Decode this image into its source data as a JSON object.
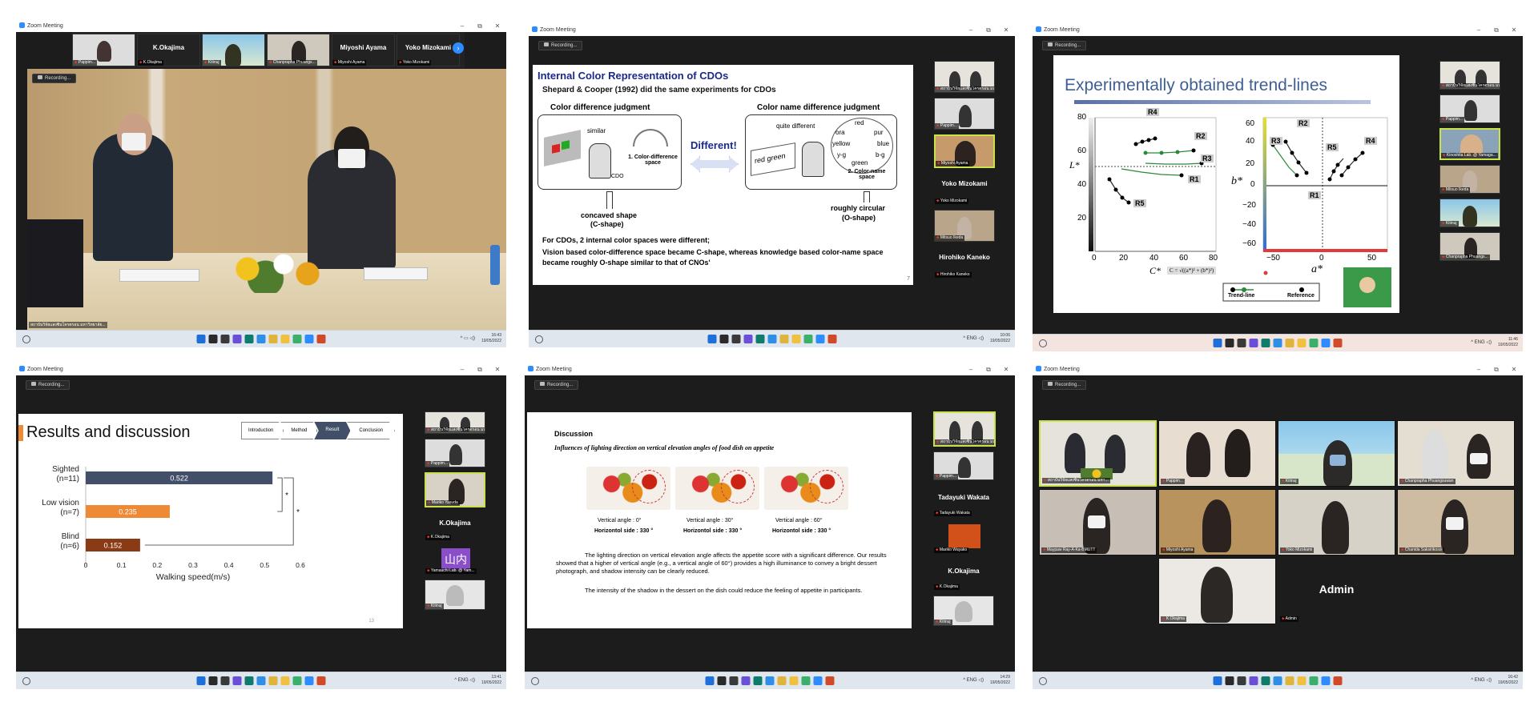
{
  "app_title": "Zoom Meeting",
  "recording_label": "Recording...",
  "win_controls": {
    "min": "–",
    "max": "⧉",
    "close": "✕"
  },
  "taskbar_lang": "ENG",
  "panels": [
    {
      "time": "16:43",
      "date": "19/05/2022"
    },
    {
      "time": "10:06",
      "date": "19/05/2022"
    },
    {
      "time": "11:46",
      "date": "19/05/2022"
    },
    {
      "time": "13:41",
      "date": "19/05/2022"
    },
    {
      "time": "14:29",
      "date": "19/05/2022"
    },
    {
      "time": "16:42",
      "date": "19/05/2022"
    }
  ],
  "p1": {
    "strip": [
      {
        "label": "Pappim..."
      },
      {
        "name": "K.Okajima",
        "label": "K.Okajima"
      },
      {
        "label": "Kitinuj"
      },
      {
        "label": "Chanprapha Phuangs..."
      },
      {
        "name": "Miyoshi Ayama",
        "label": "Miyoshi Ayama"
      },
      {
        "name": "Yoko Mizokami",
        "label": "Yoko Mizokami"
      }
    ],
    "main_caption": "สถาบันวิจัยแสงซินโครตรอน มหาวิทยาลัย..."
  },
  "p2": {
    "slide_title": "Internal Color Representation of CDOs",
    "subtitle": "Shepard & Cooper (1992) did the same experiments for CDOs",
    "left_heading": "Color difference judgment",
    "similar": "similar",
    "cd_space": "1. Color-difference space",
    "cdo": "CDO",
    "different": "Different!",
    "right_heading": "Color name difference judgment",
    "quite_diff": "quite different",
    "red_green": "red  green",
    "colors": [
      "red",
      "ora",
      "pur",
      "yellow",
      "blue",
      "y-g",
      "b-g",
      "green"
    ],
    "cn_space": "2. Color-name space",
    "concave": "concaved shape",
    "cshape": "(C-shape)",
    "circular": "roughly circular",
    "oshape": "(O-shape)",
    "body": "For CDOs, 2 internal color spaces were different;",
    "body2": "Vision based color-difference space became C-shape, whereas knowledge based color-name space became roughly O-shape similar to that of CNOs'",
    "page": "7",
    "sidebar": [
      {
        "label": "สถาบันวิจัยแสงซินโครตรอน มหา..."
      },
      {
        "label": "Pappim..."
      },
      {
        "label": "Miyoshi Ayama"
      },
      {
        "name": "Yoko Mizokami",
        "label": "Yoko Mizokami"
      },
      {
        "label": "Mitsuo Ikeda"
      },
      {
        "name": "Hirohiko Kaneko",
        "label": "Hirohiko Kaneko"
      }
    ]
  },
  "p3": {
    "slide_title": "Experimentally obtained trend-lines",
    "left_ylabel": "L*",
    "left_xlabel": "C*",
    "formula": "C = √((a*)² + (b*)²)",
    "right_ylabel": "b*",
    "right_xlabel": "a*",
    "left_yticks": [
      "80",
      "60",
      "40",
      "20"
    ],
    "left_xticks": [
      "0",
      "20",
      "40",
      "60",
      "80"
    ],
    "right_yticks": [
      "60",
      "40",
      "20",
      "0",
      "−20",
      "−40",
      "−60"
    ],
    "right_xticks": [
      "−50",
      "0",
      "50"
    ],
    "r_labels": [
      "R1",
      "R2",
      "R3",
      "R4",
      "R5"
    ],
    "legend_trend": "Trend-line",
    "legend_ref": "Reference",
    "sidebar": [
      {
        "label": "สถาบันวิจัยแสงซินโครตรอน มหา..."
      },
      {
        "label": "Pappim..."
      },
      {
        "label": "Kinoshita Lab. @ Yamaga..."
      },
      {
        "label": "Mitsuo Ikeda"
      },
      {
        "label": "Kitinuj"
      },
      {
        "label": "Chanprapha Phuangs..."
      }
    ]
  },
  "p4": {
    "slide_title": "Results and discussion",
    "nav": [
      "Introduction",
      "Method",
      "Result",
      "Conclusion"
    ],
    "nav_active": 2,
    "page": "13",
    "sidebar": [
      {
        "label": "สถาบันวิจัยแสงซินโครตรอน มหา..."
      },
      {
        "label": "Pappim..."
      },
      {
        "label": "Mariko Yasuda"
      },
      {
        "name": "K.Okajima",
        "label": "K.Okajima"
      },
      {
        "avatar": "山内",
        "label": "Yamauchi Lab. @ Yam..."
      },
      {
        "label": "Kitinuj"
      }
    ]
  },
  "chart_data": {
    "type": "bar",
    "orientation": "horizontal",
    "categories": [
      "Sighted\n(n=11)",
      "Low vision\n(n=7)",
      "Blind\n(n=6)"
    ],
    "category_lines": [
      [
        "Sighted",
        "(n=11)"
      ],
      [
        "Low vision",
        "(n=7)"
      ],
      [
        "Blind",
        "(n=6)"
      ]
    ],
    "values": [
      0.522,
      0.235,
      0.152
    ],
    "value_labels": [
      "0.522",
      "0.235",
      "0.152"
    ],
    "colors": [
      "#424f68",
      "#ee8a35",
      "#8b3a16"
    ],
    "xlabel": "Walking speed(m/s)",
    "xticks": [
      "0",
      "0.1",
      "0.2",
      "0.3",
      "0.4",
      "0.5",
      "0.6"
    ],
    "xlim": [
      0,
      0.6
    ],
    "significance": [
      "*",
      "*"
    ]
  },
  "p5": {
    "heading": "Discussion",
    "subheading": "Influences of lighting direction on vertical elevation angles of food dish on appetite",
    "captions": [
      {
        "v": "Vertical angle : 0°",
        "h": "Horizontol side : 330 °"
      },
      {
        "v": "Vertical angle : 30°",
        "h": "Horizontol side : 330 °"
      },
      {
        "v": "Vertical angle : 60°",
        "h": "Horizontol side : 330 °"
      }
    ],
    "para1": "The lighting direction on vertical elevation angle affects the appetite score with a significant difference. Our results showed that a higher of vertical angle (e.g., a vertical angle of 60°) provides a high illuminance to convey a bright dessert photograph, and shadow intensity can be clearly reduced.",
    "para2": "The intensity of the shadow in the dessert on the dish could reduce the feeling of appetite in participants.",
    "sidebar": [
      {
        "label": "สถาบันวิจัยแสงซินโครตรอน มหา..."
      },
      {
        "label": "Pappim..."
      },
      {
        "name": "Tadayuki Wakata",
        "label": "Tadayuki Wakata"
      },
      {
        "label": "Mariko Wayako"
      },
      {
        "name": "K.Okajima",
        "label": "K.Okajima"
      },
      {
        "label": "Kitinuj"
      }
    ]
  },
  "p6": {
    "tiles": [
      {
        "label": "สถาบันวิจัยแสงซินโครตรอน มหา..."
      },
      {
        "label": "Pappim..."
      },
      {
        "label": "Kitinuj"
      },
      {
        "label": "Chanprapha Phuangsuwan"
      },
      {
        "label": "Maypaw Ray-A-Ka-BMUTT"
      },
      {
        "label": "Miyoshi Ayama"
      },
      {
        "label": "Yoko Mizokami"
      },
      {
        "label": "Chanida Saksirikosol"
      },
      {
        "label": "K.Okajima"
      },
      {
        "name": "Admin",
        "label": "Admin"
      }
    ]
  }
}
